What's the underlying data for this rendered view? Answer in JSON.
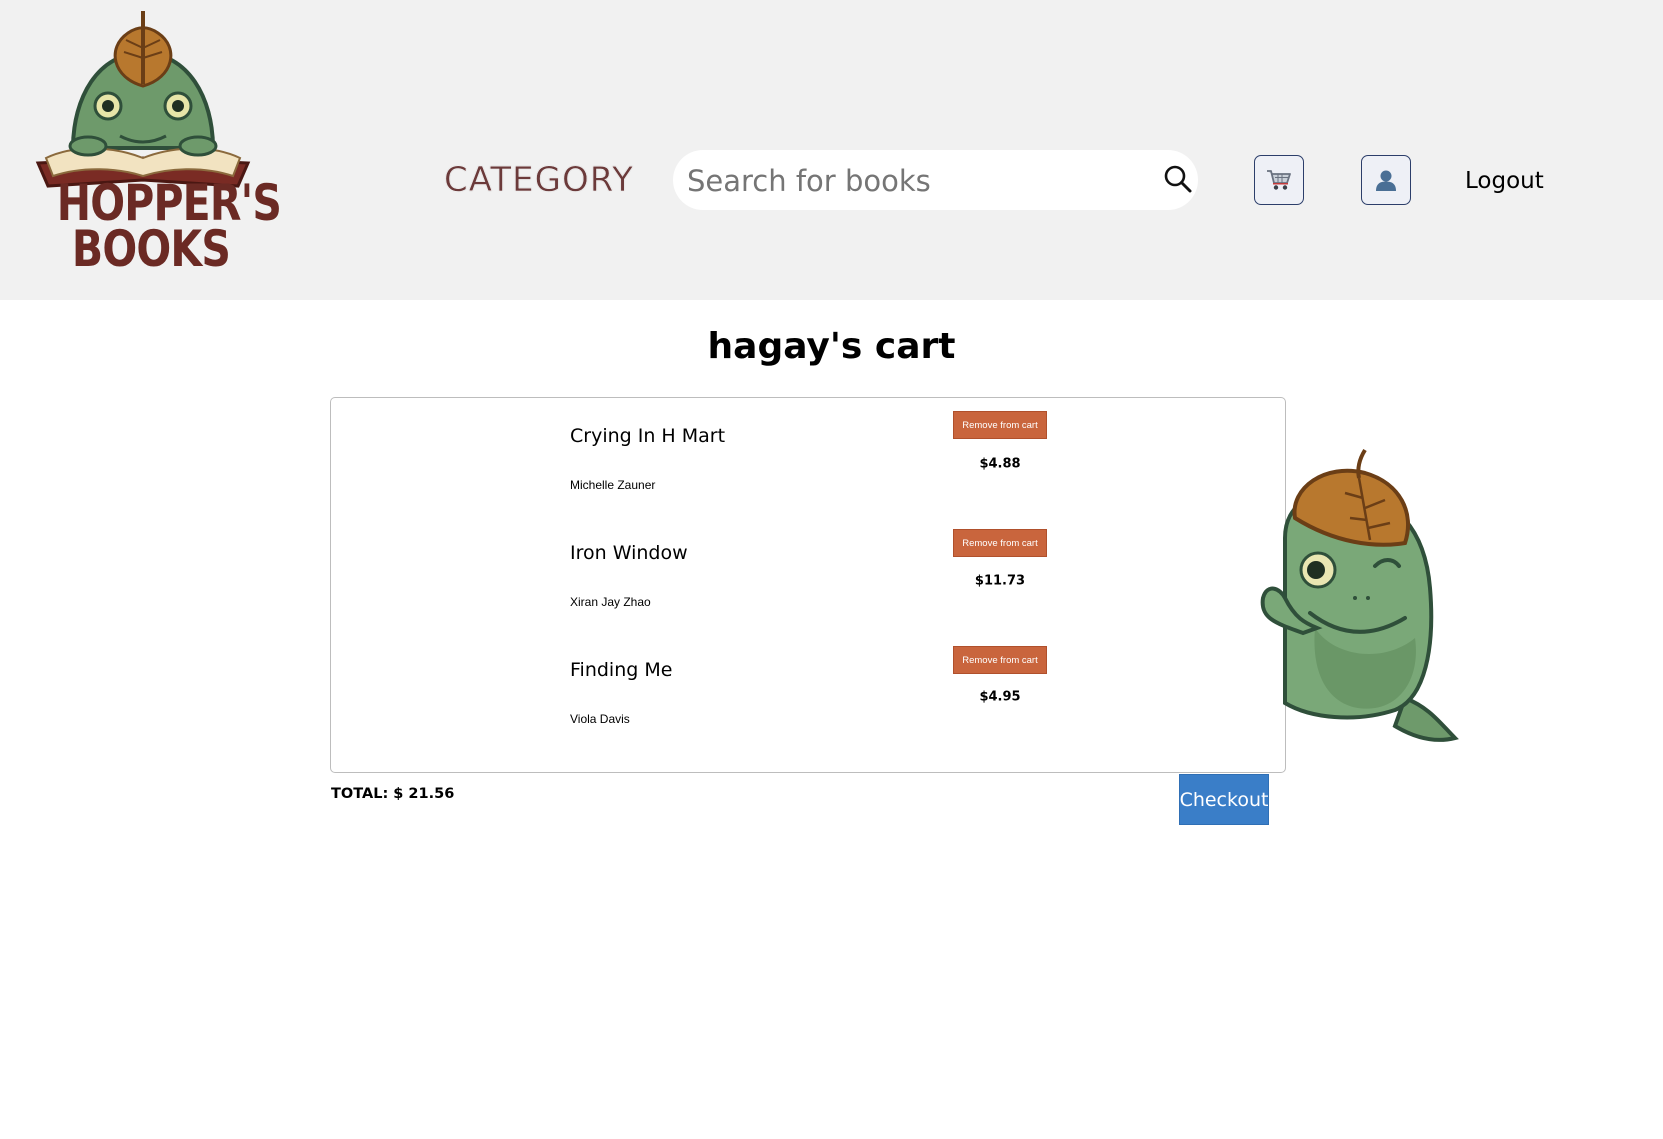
{
  "header": {
    "logo_lines": [
      "HOPPER'S",
      "BOOKS"
    ],
    "category_label": "CATEGORY",
    "search": {
      "placeholder": "Search for books",
      "value": ""
    },
    "cart_icon": "cart-icon",
    "user_icon": "user-icon",
    "logout_label": "Logout"
  },
  "cart": {
    "title": "hagay's cart",
    "items": [
      {
        "title": "Crying In H Mart",
        "author": "Michelle Zauner",
        "remove_label": "Remove from cart",
        "price": "$4.88"
      },
      {
        "title": "Iron Window",
        "author": "Xiran Jay Zhao",
        "remove_label": "Remove from cart",
        "price": "$11.73"
      },
      {
        "title": "Finding Me",
        "author": "Viola Davis",
        "remove_label": "Remove from cart",
        "price": "$4.95"
      }
    ],
    "total": "TOTAL: $ 21.56",
    "checkout_label": "Checkout"
  },
  "colors": {
    "header_bg": "#f1f1f1",
    "remove_button": "#c9653d",
    "checkout_button": "#3a7ec8",
    "logo_text": "#6b2a24"
  }
}
